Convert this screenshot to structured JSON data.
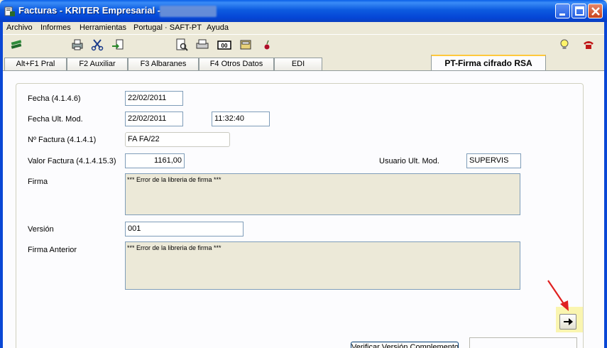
{
  "window": {
    "title": "Facturas - KRITER Empresarial - [PORTUGAL]",
    "title_visible": "Facturas - KRITER Empresarial - ",
    "controls": [
      "minimize-icon",
      "maximize-icon",
      "close-icon"
    ]
  },
  "menu": [
    "Archivo",
    "Informes",
    "Herramientas",
    "Portugal · SAFT-PT",
    "Ayuda"
  ],
  "toolbar": {
    "icons": [
      "books-icon",
      "printer-icon",
      "scissors-icon",
      "export-icon",
      "print-preview-icon",
      "print-icon",
      "counter-icon",
      "calculator-icon",
      "cherry-icon",
      "lightbulb-icon",
      "phone-icon"
    ],
    "counter_label": "00"
  },
  "tabs": [
    "Alt+F1 Pral",
    "F2 Auxiliar",
    "F3 Albaranes",
    "F4 Otros Datos",
    "EDI",
    "PT-Firma cifrado RSA"
  ],
  "active_tab": "PT-Firma cifrado RSA",
  "form": {
    "fecha_label": "Fecha (4.1.4.6)",
    "fecha_value": "22/02/2011",
    "fecha_ult_mod_label": "Fecha Ult. Mod.",
    "fecha_ult_mod_value": "22/02/2011",
    "hora_ult_mod_value": "11:32:40",
    "n_factura_label": "Nº Factura (4.1.4.1)",
    "n_factura_value": "FA FA/22",
    "valor_factura_label": "Valor Factura (4.1.4.15.3)",
    "valor_factura_value": "1161,00",
    "usuario_label": "Usuario Ult. Mod.",
    "usuario_value": "SUPERVIS",
    "firma_label": "Firma",
    "firma_value": "*** Error de la libreria de firma ***",
    "version_label": "Versión",
    "version_value": "001",
    "firma_anterior_label": "Firma Anterior",
    "firma_anterior_value": "*** Error de la libreria de firma ***"
  },
  "buttons": {
    "verificar_label": "Verificar Versión Complemento"
  },
  "colors": {
    "titlebar": "#0a5fe8",
    "active_tab_accent": "#ffc83c",
    "memo_bg": "#ece9d8",
    "highlight": "#faf5b0",
    "annotation_arrow": "#e02020"
  }
}
